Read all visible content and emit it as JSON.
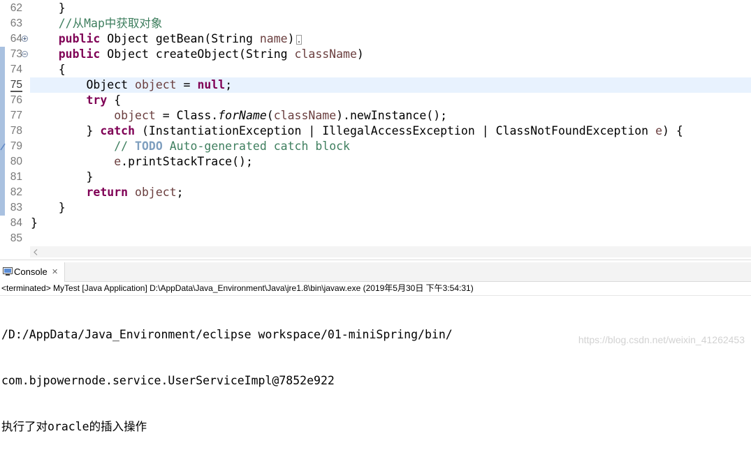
{
  "theme": {
    "keyword": "#7f0055",
    "comment": "#3f7f5f",
    "todo": "#7f9fbf",
    "variable": "#6a3e3e",
    "line_number": "#787878",
    "current_line_bg": "#e8f2fe",
    "change_bar": "#a9c1e0",
    "watermark": "#d2d2d2"
  },
  "icons": {
    "console_tab": "console-icon",
    "close_tab": "close-icon",
    "fold_expand": "fold-expand-icon",
    "fold_collapse": "fold-collapse-icon",
    "scroll_left": "scroll-left-icon",
    "task_marker": "task-marker-icon",
    "collapsed_block": "folded-code-marker"
  },
  "editor": {
    "lines": [
      {
        "num": "62",
        "tokens": [
          {
            "txt": "    }"
          }
        ]
      },
      {
        "num": "63",
        "tokens": [
          {
            "txt": "    "
          },
          {
            "cm": "//从Map中获取对象"
          }
        ]
      },
      {
        "num": "64",
        "fold_expand": true,
        "collapsed_block": true,
        "tokens": [
          {
            "txt": "    "
          },
          {
            "kw": "public"
          },
          {
            "txt": " Object getBean(String "
          },
          {
            "var": "name"
          },
          {
            "txt": ")"
          }
        ]
      },
      {
        "num": "73",
        "fold_collapse": true,
        "changed": true,
        "tokens": [
          {
            "txt": "    "
          },
          {
            "kw": "public"
          },
          {
            "txt": " Object createObject(String "
          },
          {
            "var": "className"
          },
          {
            "txt": ")"
          }
        ]
      },
      {
        "num": "74",
        "changed": true,
        "tokens": [
          {
            "txt": "    {"
          }
        ]
      },
      {
        "num": "75",
        "changed": true,
        "current": true,
        "tokens": [
          {
            "txt": "        Object "
          },
          {
            "var": "object"
          },
          {
            "txt": " = "
          },
          {
            "kw": "null"
          },
          {
            "txt": ";"
          }
        ]
      },
      {
        "num": "76",
        "changed": true,
        "tokens": [
          {
            "txt": "        "
          },
          {
            "kw": "try"
          },
          {
            "txt": " {"
          }
        ]
      },
      {
        "num": "77",
        "changed": true,
        "tokens": [
          {
            "txt": "            "
          },
          {
            "var": "object"
          },
          {
            "txt": " = Class."
          },
          {
            "st": "forName"
          },
          {
            "txt": "("
          },
          {
            "var": "className"
          },
          {
            "txt": ").newInstance();"
          }
        ]
      },
      {
        "num": "78",
        "changed": true,
        "tokens": [
          {
            "txt": "        } "
          },
          {
            "kw": "catch"
          },
          {
            "txt": " (InstantiationException | IllegalAccessException | ClassNotFoundException "
          },
          {
            "var": "e"
          },
          {
            "txt": ") {"
          }
        ]
      },
      {
        "num": "79",
        "changed": true,
        "task_marker": true,
        "tokens": [
          {
            "txt": "            "
          },
          {
            "cm": "// "
          },
          {
            "todo": "TODO"
          },
          {
            "cm": " Auto-generated catch block"
          }
        ]
      },
      {
        "num": "80",
        "changed": true,
        "tokens": [
          {
            "txt": "            "
          },
          {
            "var": "e"
          },
          {
            "txt": ".printStackTrace();"
          }
        ]
      },
      {
        "num": "81",
        "changed": true,
        "tokens": [
          {
            "txt": "        }"
          }
        ]
      },
      {
        "num": "82",
        "changed": true,
        "tokens": [
          {
            "txt": "        "
          },
          {
            "kw": "return"
          },
          {
            "txt": " "
          },
          {
            "var": "object"
          },
          {
            "txt": ";"
          }
        ]
      },
      {
        "num": "83",
        "changed": true,
        "tokens": [
          {
            "txt": "    }"
          }
        ]
      },
      {
        "num": "84",
        "tokens": [
          {
            "txt": "}"
          }
        ]
      },
      {
        "num": "85",
        "tokens": []
      }
    ]
  },
  "console": {
    "tab_label": "Console",
    "close_glyph": "✕",
    "header": "<terminated> MyTest [Java Application] D:\\AppData\\Java_Environment\\Java\\jre1.8\\bin\\javaw.exe (2019年5月30日 下午3:54:31)",
    "output": [
      "/D:/AppData/Java_Environment/eclipse workspace/01-miniSpring/bin/",
      "com.bjpowernode.service.UserServiceImpl@7852e922",
      "执行了对oracle的插入操作"
    ]
  },
  "watermark": "https://blog.csdn.net/weixin_41262453"
}
